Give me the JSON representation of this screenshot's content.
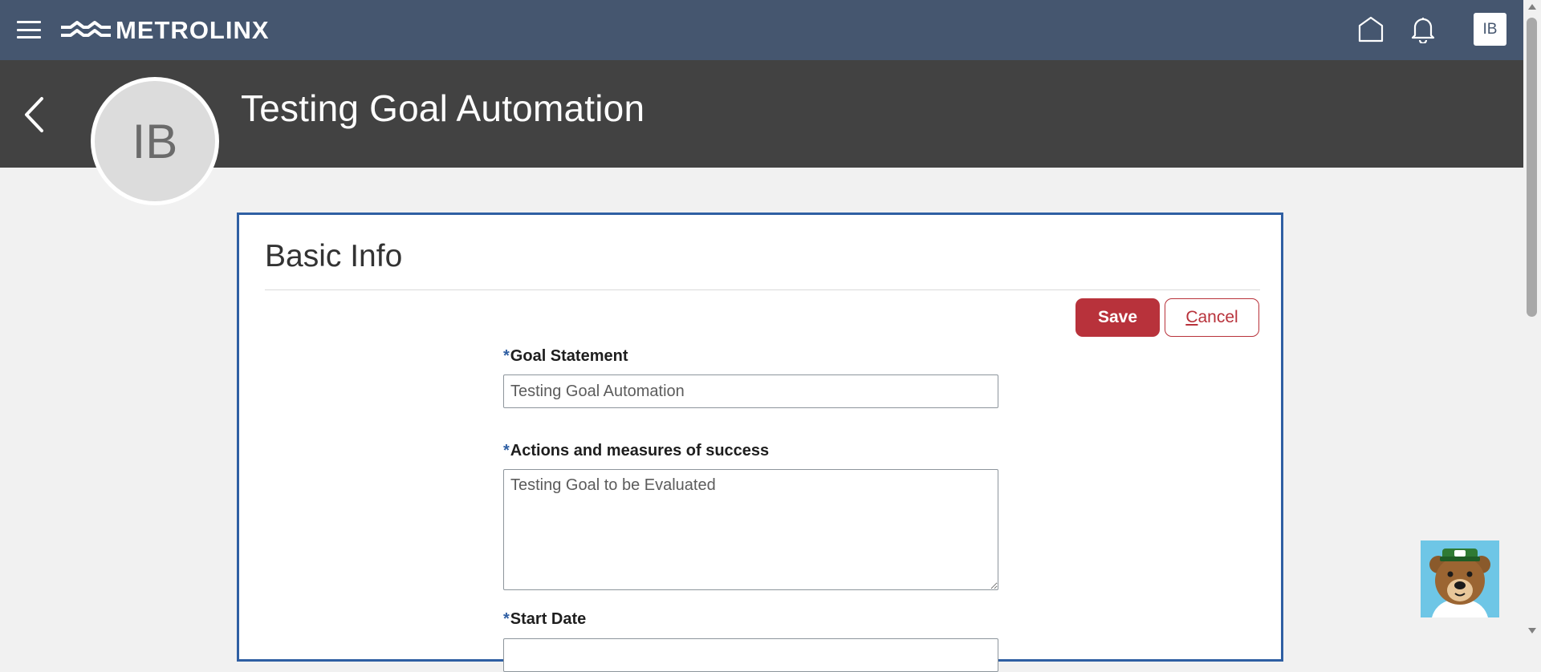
{
  "app": {
    "brand": "METROLINX",
    "user_initials": "IB"
  },
  "header": {
    "title": "Testing Goal Automation",
    "avatar_initials": "IB"
  },
  "form": {
    "section_title": "Basic Info",
    "save_label": "Save",
    "cancel_first_letter": "C",
    "cancel_rest": "ancel",
    "required_marker": "*",
    "goal_statement_label": "Goal Statement",
    "goal_statement_value": "Testing Goal Automation",
    "actions_label": "Actions and measures of success",
    "actions_value": "Testing Goal to be Evaluated",
    "start_date_label": "Start Date"
  },
  "colors": {
    "topbar": "#45566f",
    "header_band": "#424242",
    "accent_red": "#b8323b",
    "card_border": "#2f5fa3"
  },
  "icons": [
    "hamburger-icon",
    "metrolinx-logo-icon",
    "home-icon",
    "bell-icon",
    "chevron-left-icon",
    "mascot-bear-icon"
  ]
}
